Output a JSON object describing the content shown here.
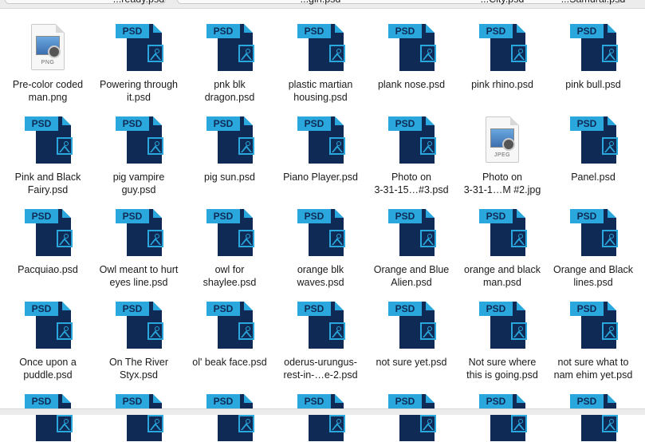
{
  "partial_row_labels": [
    "...ready.psd",
    "...girl.psd",
    "...City.psd",
    "...Samurai.psd"
  ],
  "files": [
    {
      "name": "Pre-color coded man.png",
      "type": "png",
      "ext": "PNG",
      "lines": [
        "Pre-color coded",
        "man.png"
      ]
    },
    {
      "name": "Powering through it.psd",
      "type": "psd",
      "ext": "PSD",
      "lines": [
        "Powering through",
        "it.psd"
      ]
    },
    {
      "name": "pnk blk dragon.psd",
      "type": "psd",
      "ext": "PSD",
      "lines": [
        "pnk blk",
        "dragon.psd"
      ]
    },
    {
      "name": "plastic martian housing.psd",
      "type": "psd",
      "ext": "PSD",
      "lines": [
        "plastic martian",
        "housing.psd"
      ]
    },
    {
      "name": "plank nose.psd",
      "type": "psd",
      "ext": "PSD",
      "lines": [
        "plank nose.psd",
        ""
      ]
    },
    {
      "name": "pink rhino.psd",
      "type": "psd",
      "ext": "PSD",
      "lines": [
        "pink rhino.psd",
        ""
      ]
    },
    {
      "name": "pink bull.psd",
      "type": "psd",
      "ext": "PSD",
      "lines": [
        "pink bull.psd",
        ""
      ]
    },
    {
      "name": "Pink and Black Fairy.psd",
      "type": "psd",
      "ext": "PSD",
      "lines": [
        "Pink and Black",
        "Fairy.psd"
      ]
    },
    {
      "name": "pig vampire guy.psd",
      "type": "psd",
      "ext": "PSD",
      "lines": [
        "pig vampire",
        "guy.psd"
      ]
    },
    {
      "name": "pig sun.psd",
      "type": "psd",
      "ext": "PSD",
      "lines": [
        "pig sun.psd",
        ""
      ]
    },
    {
      "name": "Piano Player.psd",
      "type": "psd",
      "ext": "PSD",
      "lines": [
        "Piano Player.psd",
        ""
      ]
    },
    {
      "name": "Photo on 3-31-15...#3.psd",
      "type": "psd",
      "ext": "PSD",
      "lines": [
        "Photo on",
        "3-31-15…#3.psd"
      ]
    },
    {
      "name": "Photo on 3-31-1...M #2.jpg",
      "type": "jpeg",
      "ext": "JPEG",
      "lines": [
        "Photo on",
        "3-31-1…M #2.jpg"
      ]
    },
    {
      "name": "Panel.psd",
      "type": "psd",
      "ext": "PSD",
      "lines": [
        "Panel.psd",
        ""
      ]
    },
    {
      "name": "Pacquiao.psd",
      "type": "psd",
      "ext": "PSD",
      "lines": [
        "Pacquiao.psd",
        ""
      ]
    },
    {
      "name": "Owl meant to hurt eyes line.psd",
      "type": "psd",
      "ext": "PSD",
      "lines": [
        "Owl meant to hurt",
        "eyes line.psd"
      ]
    },
    {
      "name": "owl for shaylee.psd",
      "type": "psd",
      "ext": "PSD",
      "lines": [
        "owl for",
        "shaylee.psd"
      ]
    },
    {
      "name": "orange blk waves.psd",
      "type": "psd",
      "ext": "PSD",
      "lines": [
        "orange blk",
        "waves.psd"
      ]
    },
    {
      "name": "Orange and Blue Alien.psd",
      "type": "psd",
      "ext": "PSD",
      "lines": [
        "Orange and Blue",
        "Alien.psd"
      ]
    },
    {
      "name": "orange and black man.psd",
      "type": "psd",
      "ext": "PSD",
      "lines": [
        "orange and black",
        "man.psd"
      ]
    },
    {
      "name": "Orange and Black lines.psd",
      "type": "psd",
      "ext": "PSD",
      "lines": [
        "Orange and Black",
        "lines.psd"
      ]
    },
    {
      "name": "Once upon a puddle.psd",
      "type": "psd",
      "ext": "PSD",
      "lines": [
        "Once upon a",
        "puddle.psd"
      ]
    },
    {
      "name": "On The River Styx.psd",
      "type": "psd",
      "ext": "PSD",
      "lines": [
        "On The River",
        "Styx.psd"
      ]
    },
    {
      "name": "ol' beak face.psd",
      "type": "psd",
      "ext": "PSD",
      "lines": [
        "ol' beak face.psd",
        ""
      ]
    },
    {
      "name": "oderus-urungus-rest-in-...e-2.psd",
      "type": "psd",
      "ext": "PSD",
      "lines": [
        "oderus-urungus-",
        "rest-in-…e-2.psd"
      ]
    },
    {
      "name": "not sure yet.psd",
      "type": "psd",
      "ext": "PSD",
      "lines": [
        "not sure yet.psd",
        ""
      ]
    },
    {
      "name": "Not sure where this is going.psd",
      "type": "psd",
      "ext": "PSD",
      "lines": [
        "Not sure where",
        "this is going.psd"
      ]
    },
    {
      "name": "not sure what to nam ehim yet.psd",
      "type": "psd",
      "ext": "PSD",
      "lines": [
        "not sure what to",
        "nam ehim yet.psd"
      ]
    },
    {
      "name": "",
      "type": "psd",
      "ext": "PSD",
      "lines": [
        "",
        ""
      ]
    },
    {
      "name": "",
      "type": "psd",
      "ext": "PSD",
      "lines": [
        "",
        ""
      ]
    },
    {
      "name": "",
      "type": "psd",
      "ext": "PSD",
      "lines": [
        "",
        ""
      ]
    },
    {
      "name": "",
      "type": "psd",
      "ext": "PSD",
      "lines": [
        "",
        ""
      ]
    },
    {
      "name": "",
      "type": "psd",
      "ext": "PSD",
      "lines": [
        "",
        ""
      ]
    },
    {
      "name": "",
      "type": "psd",
      "ext": "PSD",
      "lines": [
        "",
        ""
      ]
    },
    {
      "name": "",
      "type": "psd",
      "ext": "PSD",
      "lines": [
        "",
        ""
      ]
    }
  ]
}
